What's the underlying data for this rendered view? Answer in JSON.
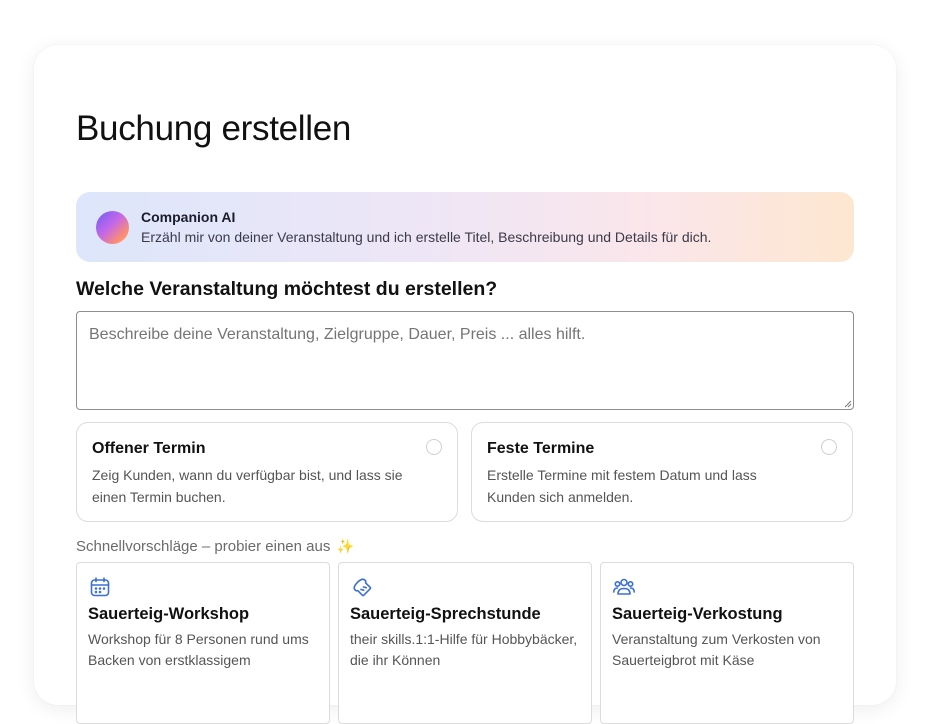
{
  "page": {
    "title": "Buchung erstellen"
  },
  "companion": {
    "name": "Companion AI",
    "message": "Erzähl mir von deiner Veranstaltung und ich erstelle Titel, Beschreibung und Details für dich."
  },
  "question": "Welche Veranstaltung möchtest du erstellen?",
  "prompt": {
    "value": "",
    "placeholder": "Beschreibe deine Veranstaltung, Zielgruppe, Dauer, Preis ... alles hilft."
  },
  "booking_types": [
    {
      "title": "Offener Termin",
      "description": "Zeig Kunden, wann du verfügbar bist, und lass sie einen Termin buchen.",
      "selected": false
    },
    {
      "title": "Feste Termine",
      "description": "Erstelle Termine mit festem Datum und lass Kunden sich anmelden.",
      "selected": false
    }
  ],
  "suggestions": {
    "label": "Schnellvorschläge – probier einen aus",
    "sparkle": "✨",
    "items": [
      {
        "icon": "calendar-icon",
        "title": "Sauerteig-Workshop",
        "description": "Workshop für 8 Personen rund ums Backen von erstklassigem"
      },
      {
        "icon": "bread-icon",
        "title": "Sauerteig-Sprechstunde",
        "description": " their skills.1:1-Hilfe für Hobbybäcker, die ihr Können"
      },
      {
        "icon": "users-icon",
        "title": "Sauerteig-Verkostung",
        "description": "Veranstaltung zum Verkosten von Sauerteigbrot mit Käse"
      }
    ]
  },
  "colors": {
    "accent": "#3b6fd8",
    "text": "#111111",
    "muted": "#555555",
    "border": "#dcdcdc"
  }
}
